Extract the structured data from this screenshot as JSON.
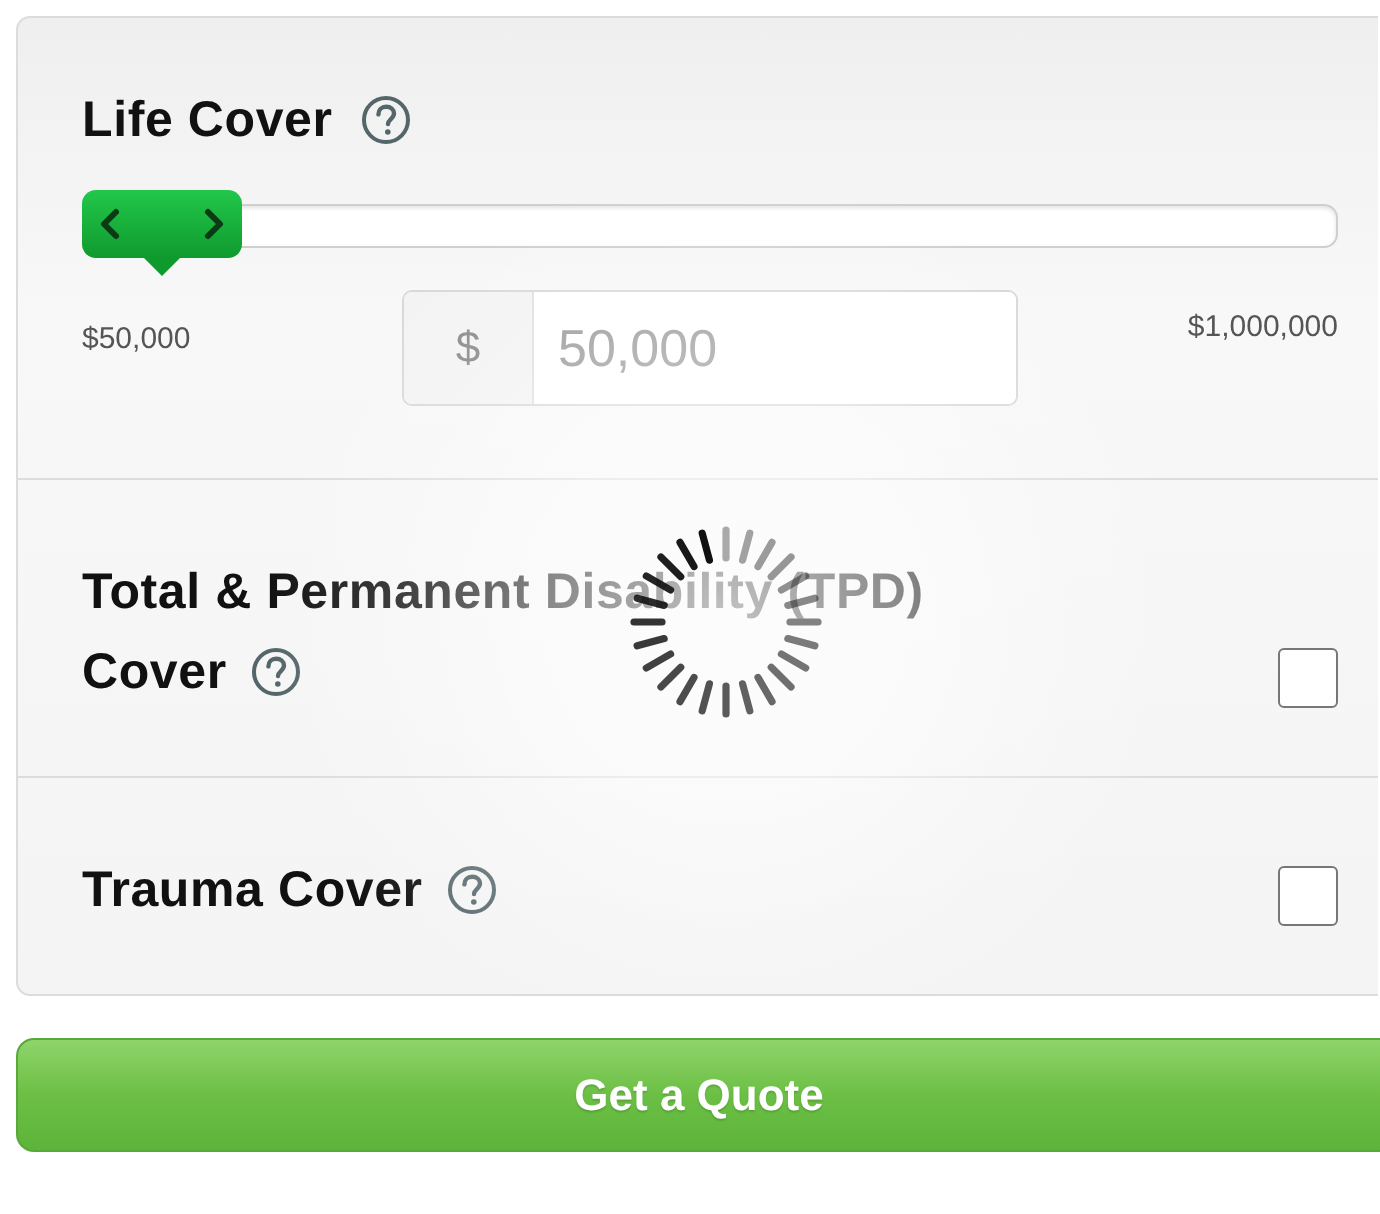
{
  "sections": [
    {
      "kind": "slider",
      "title": "Life Cover",
      "level": 0,
      "min_label": "$50,000",
      "max_label": "$1,000,000",
      "amount": {
        "prefix": "$",
        "placeholder": "50,000"
      }
    },
    {
      "kind": "checkbox",
      "title_lines": [
        "Total & Permanent Disability (TPD)",
        "Cover"
      ],
      "checked": false
    },
    {
      "kind": "checkbox",
      "title_lines": [
        "Trauma Cover"
      ],
      "checked": false
    }
  ],
  "loading": true,
  "button": "Get a Quote"
}
